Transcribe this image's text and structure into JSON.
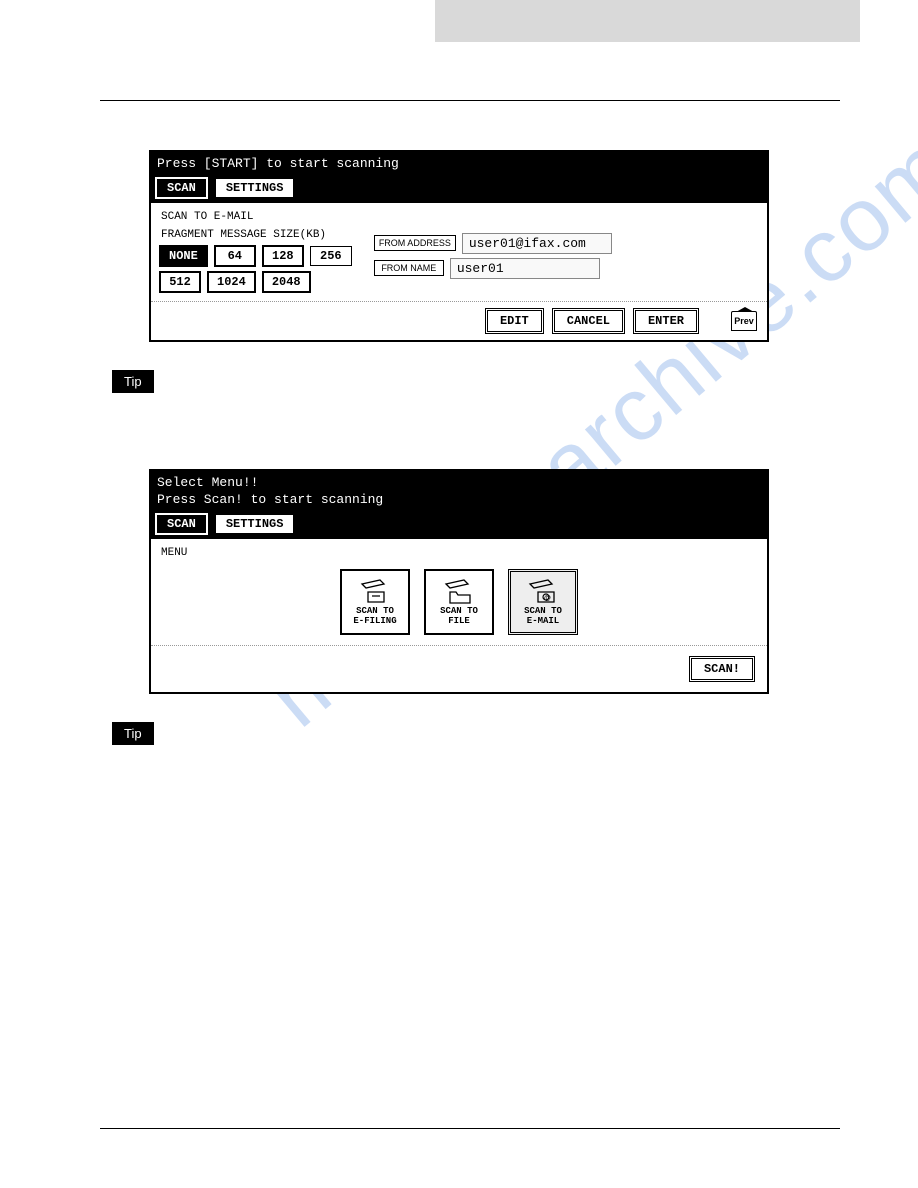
{
  "watermark": "manualsarchive.com",
  "panel1": {
    "header": "Press [START] to start scanning",
    "tabs": {
      "scan": "SCAN",
      "settings": "SETTINGS"
    },
    "subtitle": "SCAN TO E-MAIL",
    "frag_label": "FRAGMENT MESSAGE SIZE(KB)",
    "sizes": {
      "none": "NONE",
      "s64": "64",
      "s128": "128",
      "s256": "256",
      "s512": "512",
      "s1024": "1024",
      "s2048": "2048"
    },
    "from_addr_label": "FROM ADDRESS",
    "from_addr_value": "user01@ifax.com",
    "from_name_label": "FROM NAME",
    "from_name_value": "user01",
    "buttons": {
      "edit": "EDIT",
      "cancel": "CANCEL",
      "enter": "ENTER",
      "prev": "Prev"
    }
  },
  "tip_label": "Tip",
  "panel2": {
    "header_line1": "Select Menu!!",
    "header_line2": "Press Scan! to start scanning",
    "tabs": {
      "scan": "SCAN",
      "settings": "SETTINGS"
    },
    "menu_label": "MENU",
    "items": {
      "efiling_l1": "SCAN TO",
      "efiling_l2": "E-FILING",
      "file_l1": "SCAN TO",
      "file_l2": "FILE",
      "email_l1": "SCAN TO",
      "email_l2": "E-MAIL"
    },
    "scan_btn": "SCAN!"
  }
}
